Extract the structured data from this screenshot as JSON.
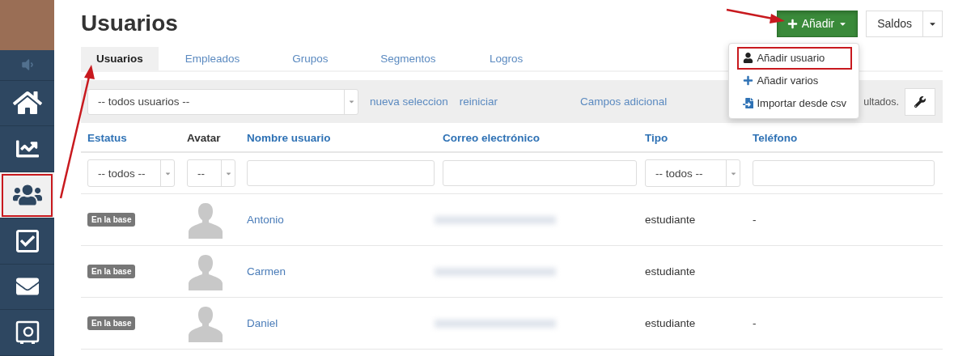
{
  "sidebar": {
    "items": [
      {
        "kind": "speaker",
        "selected": false
      },
      {
        "kind": "home",
        "selected": false
      },
      {
        "kind": "chart",
        "selected": false
      },
      {
        "kind": "users",
        "selected": true
      },
      {
        "kind": "check",
        "selected": false
      },
      {
        "kind": "mail",
        "selected": false
      },
      {
        "kind": "safe",
        "selected": false
      }
    ]
  },
  "title": "Usuarios",
  "tabs": [
    {
      "label": "Usuarios",
      "selected": true
    },
    {
      "label": "Empleados",
      "selected": false
    },
    {
      "label": "Grupos",
      "selected": false
    },
    {
      "label": "Segmentos",
      "selected": false
    },
    {
      "label": "Logros",
      "selected": false
    }
  ],
  "actions": {
    "add_button": {
      "label": "Añadir",
      "expanded": true
    },
    "balance_button": {
      "label": "Saldos"
    }
  },
  "add_menu": {
    "items": [
      {
        "kind": "user",
        "label": "Añadir usuario",
        "highlighted": true
      },
      {
        "kind": "plus",
        "label": "Añadir varios",
        "highlighted": false
      },
      {
        "kind": "import",
        "label": "Importar desde csv",
        "highlighted": false
      }
    ]
  },
  "toolbar": {
    "user_select": "-- todos usuarios --",
    "links": [
      "nueva seleccion",
      "reiniciar"
    ],
    "extra_fields_link": "Campos adicional",
    "results_text": "ultados."
  },
  "table": {
    "columns": [
      {
        "label": "Estatus",
        "sortable": true
      },
      {
        "label": "Avatar",
        "sortable": false
      },
      {
        "label": "Nombre usuario",
        "sortable": true
      },
      {
        "label": "Correo electrónico",
        "sortable": true
      },
      {
        "label": "Tipo",
        "sortable": true
      },
      {
        "label": "Teléfono",
        "sortable": true
      }
    ],
    "filters": [
      {
        "kind": "select",
        "value": "-- todos --"
      },
      {
        "kind": "select",
        "value": "--"
      },
      {
        "kind": "text"
      },
      {
        "kind": "text"
      },
      {
        "kind": "select",
        "value": "-- todos --"
      },
      {
        "kind": "text"
      }
    ],
    "rows": [
      {
        "status": "En la base",
        "name": "Antonio",
        "email_hidden": true,
        "type": "estudiante",
        "phone": "-"
      },
      {
        "status": "En la base",
        "name": "Carmen",
        "email_hidden": true,
        "type": "estudiante"
      },
      {
        "status": "En la base",
        "name": "Daniel",
        "email_hidden": true,
        "type": "estudiante",
        "phone": "-"
      }
    ]
  }
}
